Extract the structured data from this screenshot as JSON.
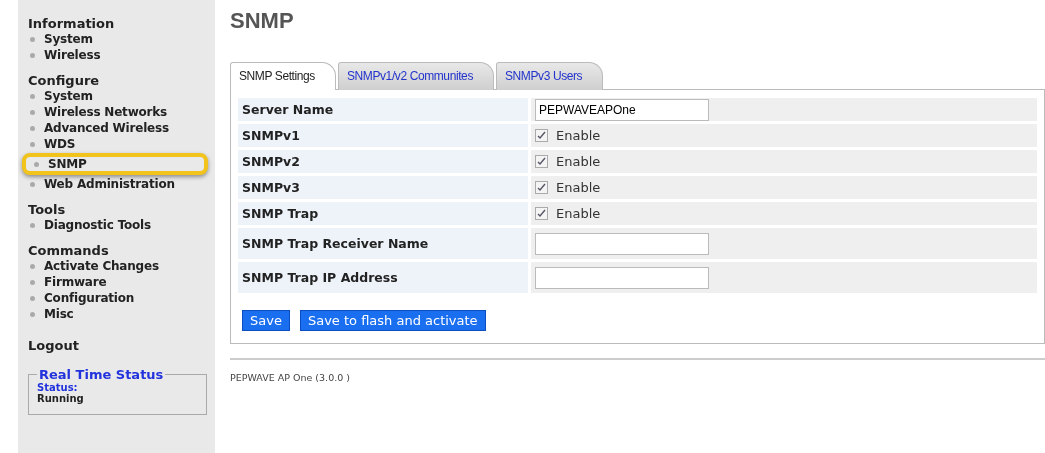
{
  "sidebar": {
    "sections": [
      {
        "title": "Information",
        "items": [
          {
            "label": "System",
            "highlighted": false
          },
          {
            "label": "Wireless",
            "highlighted": false
          }
        ]
      },
      {
        "title": "Configure",
        "items": [
          {
            "label": "System",
            "highlighted": false
          },
          {
            "label": "Wireless Networks",
            "highlighted": false
          },
          {
            "label": "Advanced Wireless",
            "highlighted": false
          },
          {
            "label": "WDS",
            "highlighted": false
          },
          {
            "label": "SNMP",
            "highlighted": true
          },
          {
            "label": "Web Administration",
            "highlighted": false
          }
        ]
      },
      {
        "title": "Tools",
        "items": [
          {
            "label": "Diagnostic Tools",
            "highlighted": false
          }
        ]
      },
      {
        "title": "Commands",
        "items": [
          {
            "label": "Activate Changes",
            "highlighted": false
          },
          {
            "label": "Firmware",
            "highlighted": false
          },
          {
            "label": "Configuration",
            "highlighted": false
          },
          {
            "label": "Misc",
            "highlighted": false
          }
        ]
      }
    ],
    "logout": "Logout",
    "status_box": {
      "title": "Real Time Status",
      "label": "Status:",
      "value": "Running"
    }
  },
  "page_title": "SNMP",
  "tabs": [
    {
      "label": "SNMP Settings",
      "selected": true
    },
    {
      "label": "SNMPv1/v2 Communites",
      "selected": false
    },
    {
      "label": "SNMPv3 Users",
      "selected": false
    }
  ],
  "settings": [
    {
      "kind": "text",
      "label": "Server Name",
      "value": "PEPWAVEAPOne"
    },
    {
      "kind": "checkbox",
      "label": "SNMPv1",
      "option": "Enable",
      "checked": true
    },
    {
      "kind": "checkbox",
      "label": "SNMPv2",
      "option": "Enable",
      "checked": true
    },
    {
      "kind": "checkbox",
      "label": "SNMPv3",
      "option": "Enable",
      "checked": true
    },
    {
      "kind": "checkbox",
      "label": "SNMP Trap",
      "option": "Enable",
      "checked": true
    },
    {
      "kind": "text",
      "label": "SNMP Trap Receiver Name"
    },
    {
      "kind": "text",
      "label": "SNMP Trap IP Address"
    }
  ],
  "buttons": [
    "Save",
    "Save to flash and activate"
  ],
  "footer": "PEPWAVE AP One (3.0.0 )"
}
